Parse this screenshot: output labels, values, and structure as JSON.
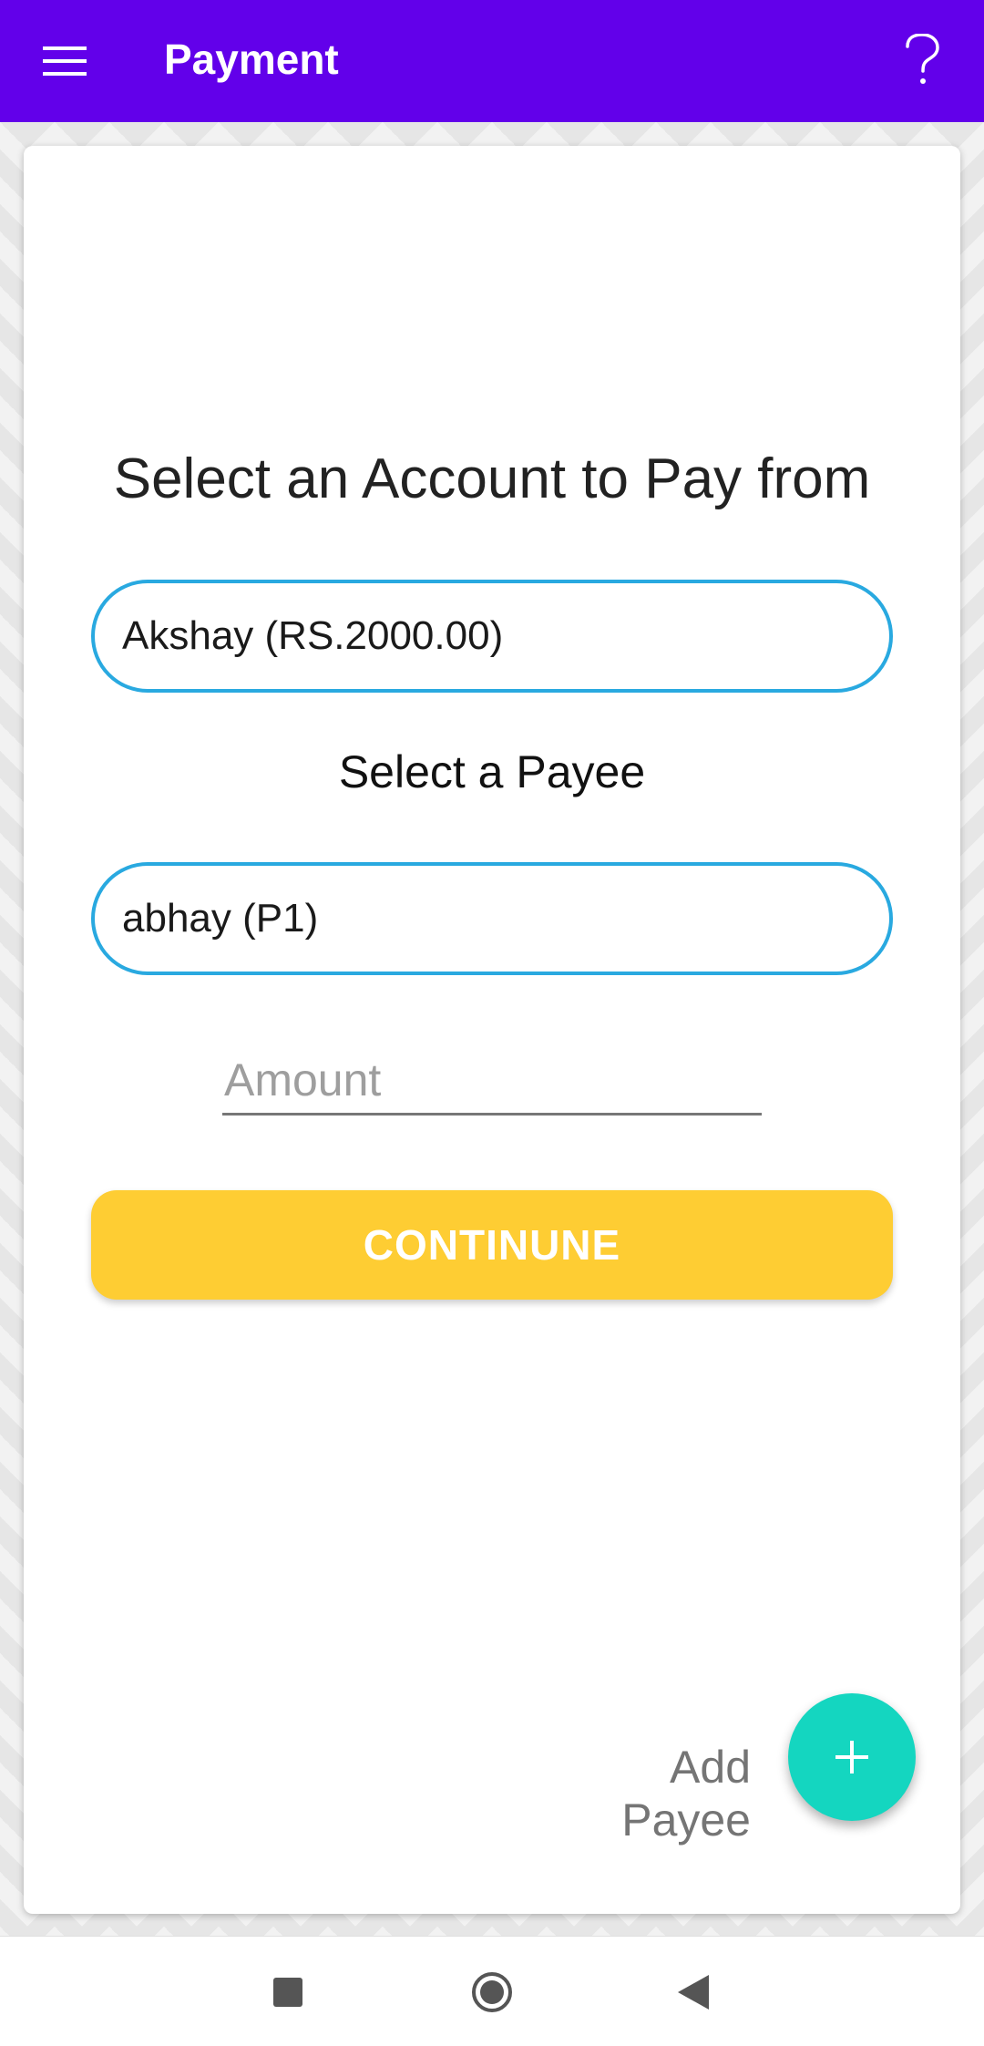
{
  "app_bar": {
    "title": "Payment",
    "menu_icon": "hamburger-menu-icon",
    "help_icon": "question-mark-icon",
    "color": "#6200ea"
  },
  "main": {
    "heading": "Select an Account to Pay from",
    "account_select": {
      "value": "Akshay (RS.2000.00)"
    },
    "payee_heading": "Select a Payee",
    "payee_select": {
      "value": "abhay (P1)"
    },
    "amount_input": {
      "placeholder": "Amount",
      "value": ""
    },
    "continue_label": "CONTINUNE",
    "add_payee_label": "Add Payee",
    "fab_icon": "plus-icon"
  },
  "colors": {
    "accent_border": "#29a9e0",
    "continue_button": "#fecd33",
    "fab": "#14d6c0"
  },
  "nav_bar": {
    "recent_icon": "square-recents-icon",
    "home_icon": "circle-home-icon",
    "back_icon": "triangle-back-icon"
  }
}
